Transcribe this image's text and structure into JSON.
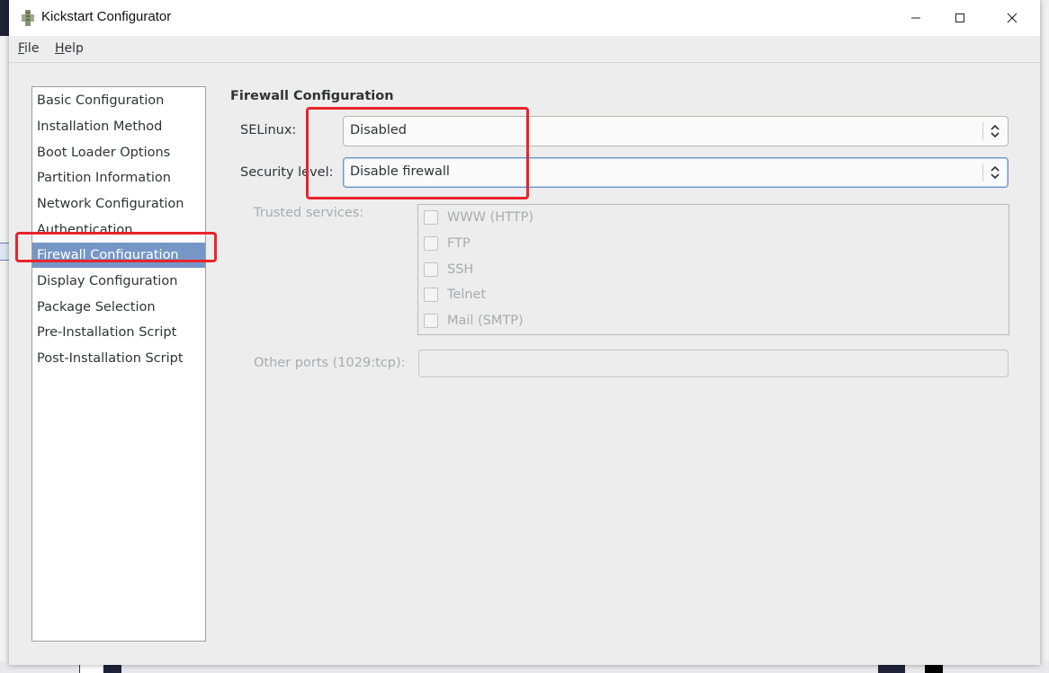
{
  "window": {
    "title": "Kickstart Configurator",
    "controls": [
      "minimize",
      "maximize",
      "close"
    ]
  },
  "menubar": {
    "file": "File",
    "help": "Help"
  },
  "sidebar": {
    "items": [
      {
        "label": "Basic Configuration",
        "selected": false
      },
      {
        "label": "Installation Method",
        "selected": false
      },
      {
        "label": "Boot Loader Options",
        "selected": false
      },
      {
        "label": "Partition Information",
        "selected": false
      },
      {
        "label": "Network Configuration",
        "selected": false
      },
      {
        "label": "Authentication",
        "selected": false
      },
      {
        "label": "Firewall Configuration",
        "selected": true
      },
      {
        "label": "Display Configuration",
        "selected": false
      },
      {
        "label": "Package Selection",
        "selected": false
      },
      {
        "label": "Pre-Installation Script",
        "selected": false
      },
      {
        "label": "Post-Installation Script",
        "selected": false
      }
    ]
  },
  "firewall": {
    "section_title": "Firewall Configuration",
    "selinux_label": "SELinux:",
    "selinux_value": "Disabled",
    "security_level_label": "Security level:",
    "security_level_value": "Disable firewall",
    "trusted_services_label": "Trusted services:",
    "services": [
      {
        "label": "WWW (HTTP)",
        "checked": false
      },
      {
        "label": "FTP",
        "checked": false
      },
      {
        "label": "SSH",
        "checked": false
      },
      {
        "label": "Telnet",
        "checked": false
      },
      {
        "label": "Mail (SMTP)",
        "checked": false
      }
    ],
    "other_ports_label": "Other ports (1029:tcp):",
    "other_ports_value": ""
  },
  "colors": {
    "selection": "#7596c6",
    "annotation": "#e8252a",
    "window_bg": "#ededed"
  }
}
